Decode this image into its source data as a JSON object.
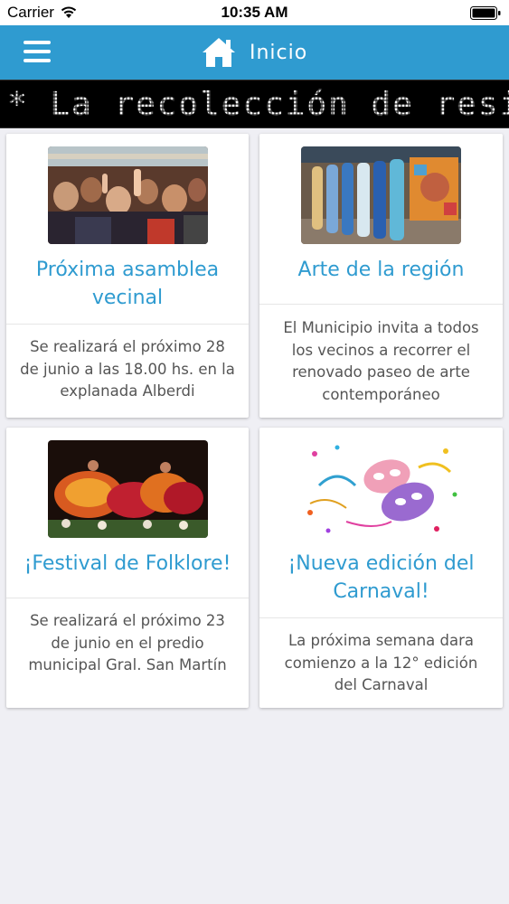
{
  "status_bar": {
    "carrier": "Carrier",
    "time": "10:35 AM"
  },
  "nav": {
    "title": "Inicio",
    "menu_icon": "hamburger-menu-icon",
    "home_icon": "home-icon",
    "color": "#2f9bd0"
  },
  "ticker": {
    "text": "* La recolección de residu"
  },
  "cards": [
    {
      "title": "Próxima asamblea vecinal",
      "text": "Se realizará el próximo 28 de junio a las 18.00 hs. en la explanada Alberdi",
      "image": "crowd-raising-hands-photo"
    },
    {
      "title": "Arte de la región",
      "text": "El Municipio invita a todos los vecinos a recorrer el renovado paseo de arte contemporáneo",
      "image": "painted-art-panels-photo"
    },
    {
      "title": "¡Festival de Folklore!",
      "text": "Se realizará el próximo 23 de junio en el predio municipal Gral. San Martín",
      "image": "folklore-dancers-photo"
    },
    {
      "title": "¡Nueva edición del Carnaval!",
      "text": "La próxima semana dara comienzo a la 12° edición del Carnaval",
      "image": "carnival-masks-photo"
    }
  ]
}
